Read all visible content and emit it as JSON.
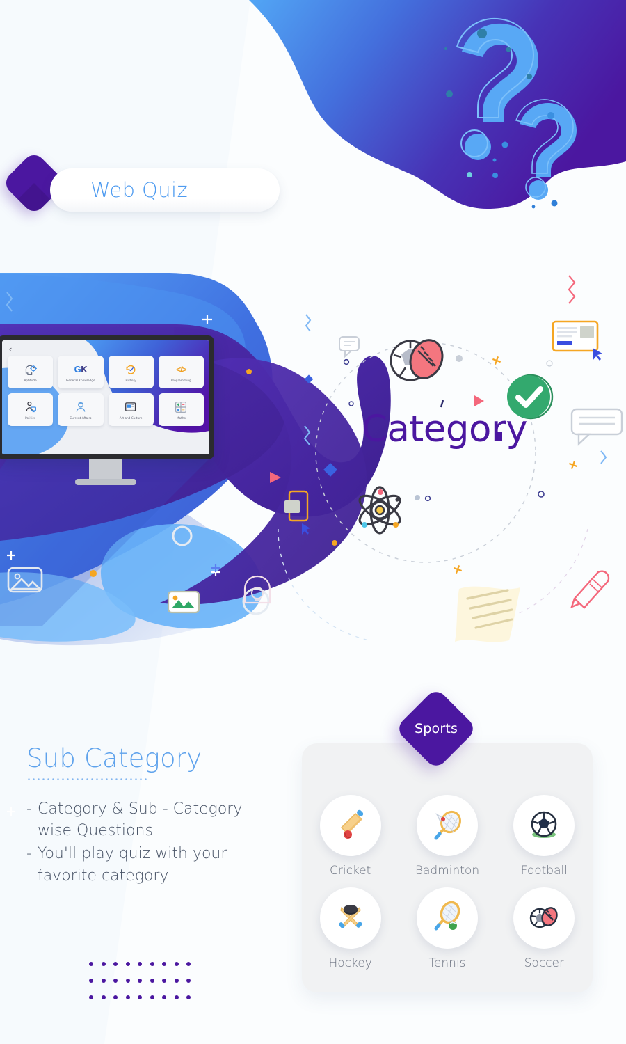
{
  "page": {
    "background_color": "#f6fafd",
    "accent_purple": "#4b17a0",
    "accent_blue": "#4e9bf0",
    "accent_green": "#2fa866",
    "accent_orange": "#f5a623",
    "accent_pink": "#f4687c"
  },
  "header": {
    "title": "Web Quiz",
    "diamond_color": "#4b17a0"
  },
  "monitor": {
    "back_arrow": "‹",
    "tiles": [
      {
        "label": "Aptitude",
        "icon": "aptitude-head-gear-icon"
      },
      {
        "label": "General Knowledge",
        "icon": "gk-text-icon",
        "text": "GK"
      },
      {
        "label": "History",
        "icon": "history-clock-icon"
      },
      {
        "label": "Programming",
        "icon": "code-brackets-icon",
        "text": "</>"
      },
      {
        "label": "Politics",
        "icon": "politics-speaker-icon"
      },
      {
        "label": "Current Affairs",
        "icon": "current-affairs-reporter-icon"
      },
      {
        "label": "Art and Culture",
        "icon": "art-culture-news-icon"
      },
      {
        "label": "Maths",
        "icon": "maths-operators-icon"
      }
    ]
  },
  "hero": {
    "category_title": "Category",
    "check_badge": "check-icon",
    "orbit_icons": [
      "football-rugby-ball-icon",
      "atom-icon"
    ]
  },
  "sub_category": {
    "heading": "Sub Category",
    "bullets": [
      {
        "dash": "-",
        "line1": "Category & Sub - Category",
        "line2": "wise Questions"
      },
      {
        "dash": "-",
        "line1": "You'll play quiz with your",
        "line2": "favorite category"
      }
    ]
  },
  "sports": {
    "badge_label": "Sports",
    "items": [
      {
        "label": "Cricket",
        "icon": "cricket-bat-ball-icon"
      },
      {
        "label": "Badminton",
        "icon": "badminton-racket-shuttle-icon"
      },
      {
        "label": "Football",
        "icon": "football-soccer-ball-icon"
      },
      {
        "label": "Hockey",
        "icon": "hockey-sticks-puck-icon"
      },
      {
        "label": "Tennis",
        "icon": "tennis-racket-ball-icon"
      },
      {
        "label": "Soccer",
        "icon": "soccer-rugby-balls-icon"
      }
    ]
  },
  "dot_grid": {
    "columns": 9,
    "rows": 3,
    "color": "#4b17a0"
  }
}
